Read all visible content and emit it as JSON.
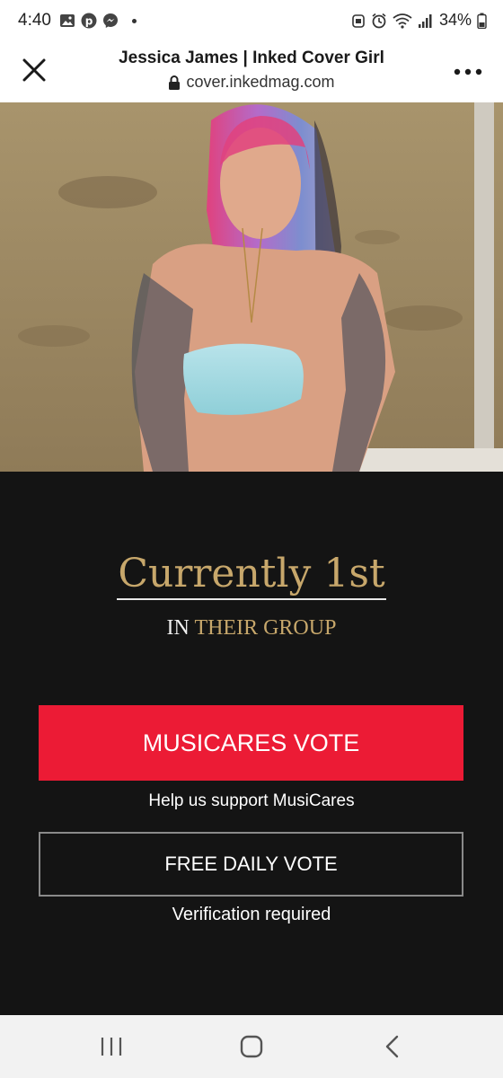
{
  "status_bar": {
    "time": "4:40",
    "battery": "34%",
    "icons": [
      "gallery-icon",
      "pinterest-icon",
      "messenger-icon",
      "notification-dot",
      "alarm-icon",
      "clock-icon",
      "wifi-icon",
      "signal-icon",
      "battery-icon"
    ]
  },
  "browser": {
    "title": "Jessica James | Inked Cover Girl",
    "url": "cover.inkedmag.com"
  },
  "ranking": {
    "title": "Currently 1st",
    "sub_prefix": "IN",
    "sub_highlight": "THEIR GROUP"
  },
  "actions": {
    "vote_label": "MUSICARES VOTE",
    "vote_caption": "Help us support MusiCares",
    "free_label": "FREE DAILY VOTE",
    "free_caption": "Verification required"
  },
  "colors": {
    "accent_gold": "#c7a76b",
    "vote_red": "#ec1b35",
    "background": "#141414"
  }
}
